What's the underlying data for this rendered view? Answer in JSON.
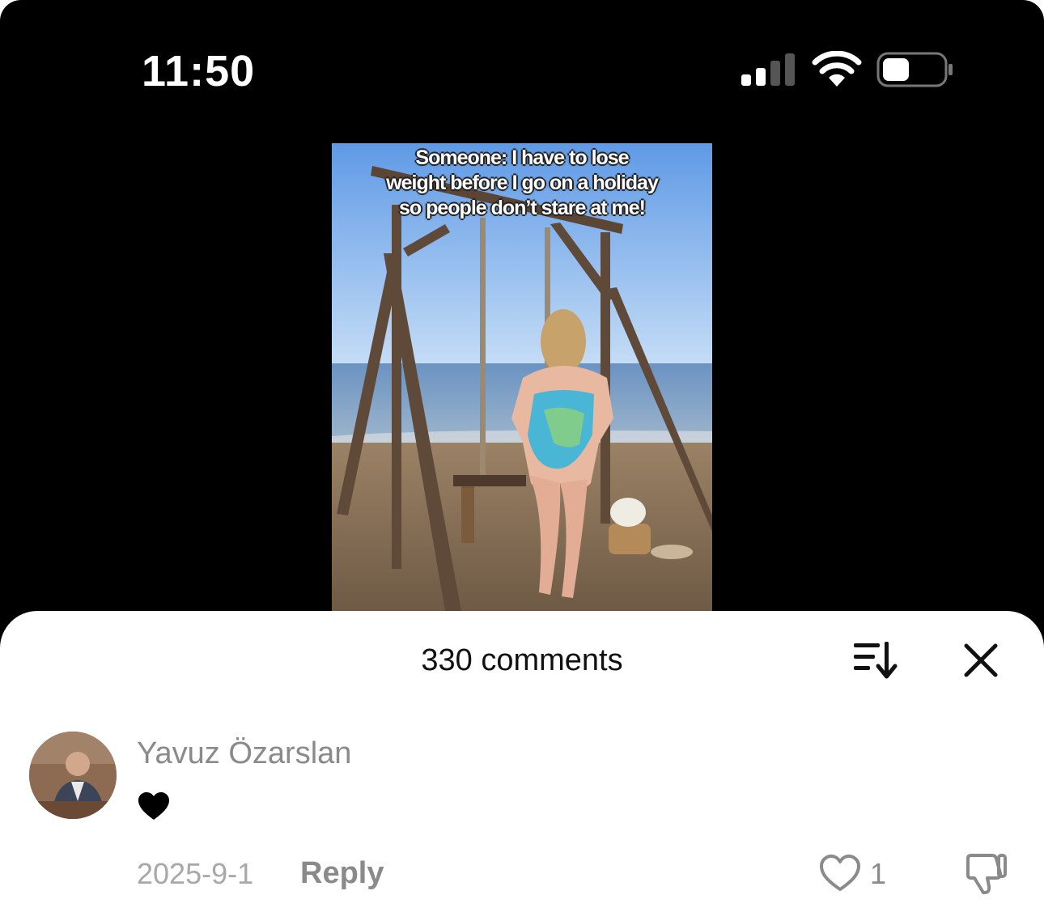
{
  "status_bar": {
    "time": "11:50",
    "icons": [
      "cellular-signal-icon",
      "wifi-icon",
      "battery-icon"
    ]
  },
  "video": {
    "caption": "Someone: I have to lose\nweight before I go on a holiday\nso people don’t stare at me!"
  },
  "comments_sheet": {
    "title": "330 comments",
    "sort_icon": "sort-icon",
    "close_icon": "close-icon",
    "comments": [
      {
        "username": "Yavuz Özarslan",
        "text_emoji": "black-heart",
        "date": "2025-9-1",
        "reply_label": "Reply",
        "likes": "1"
      }
    ]
  },
  "colors": {
    "background_dark": "#000000",
    "sheet_bg": "#ffffff",
    "secondary_text": "#8a8a8a"
  }
}
